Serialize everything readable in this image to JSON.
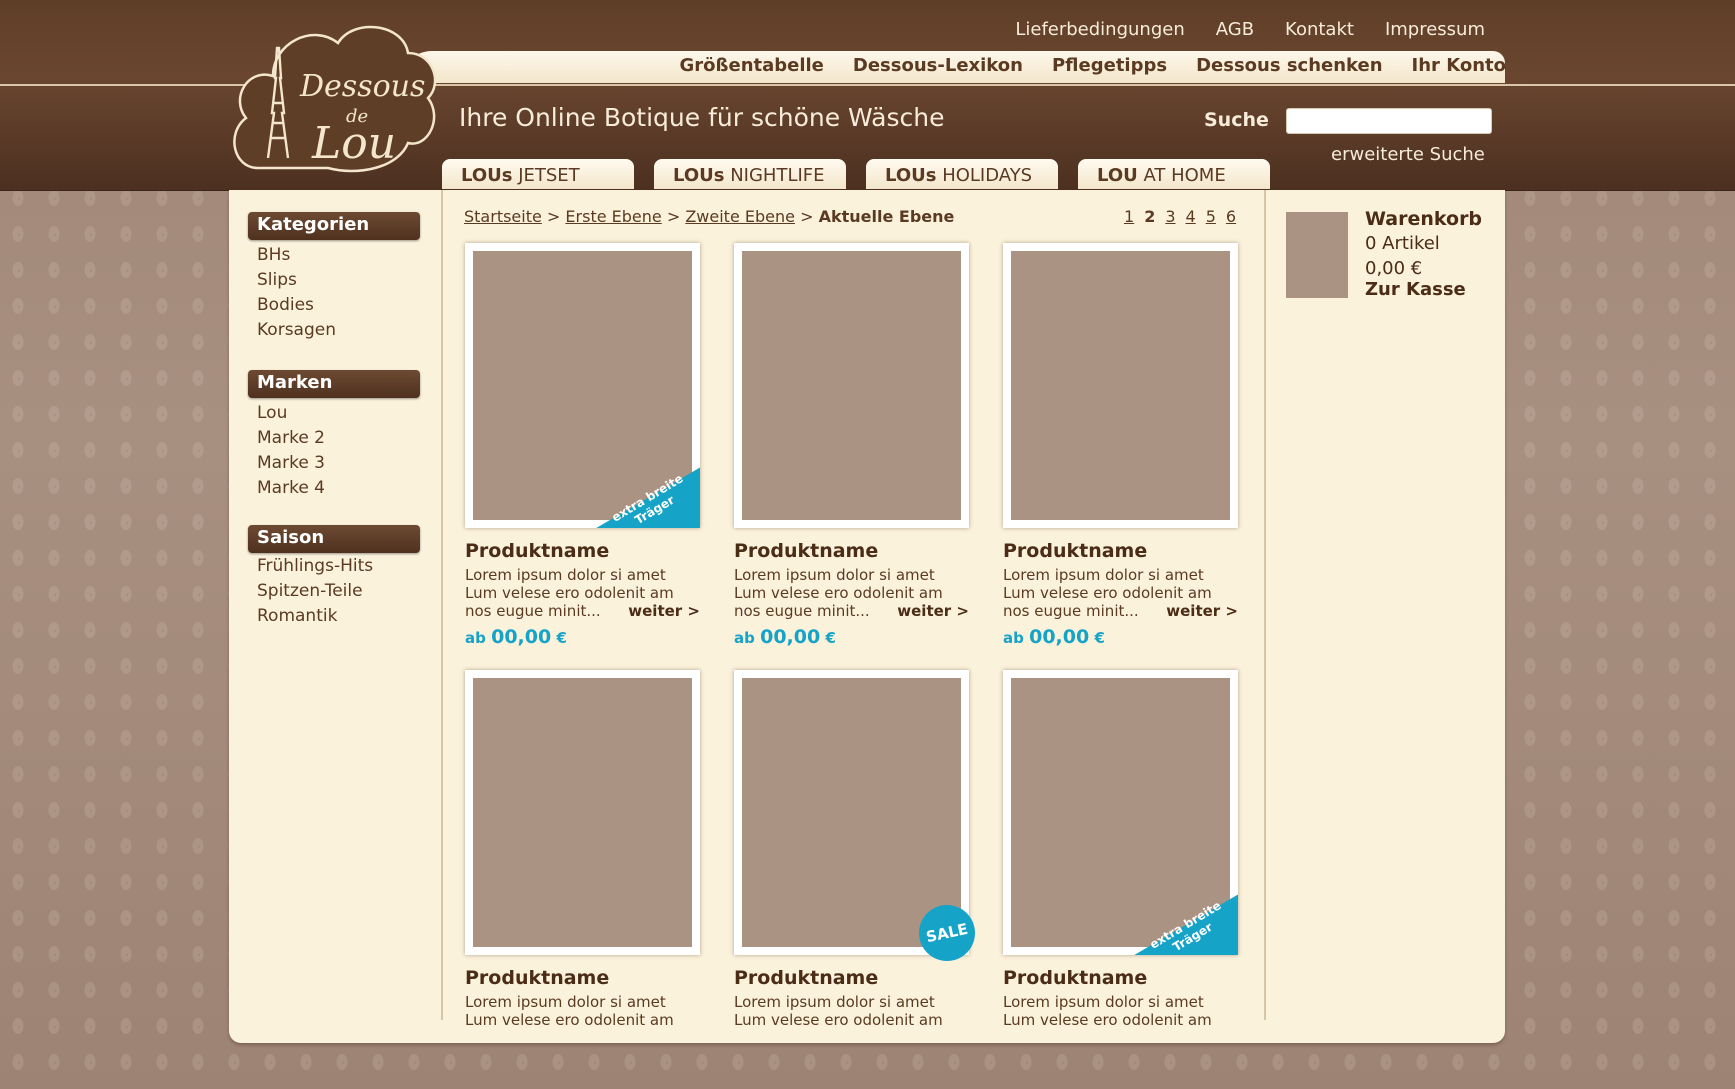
{
  "header": {
    "logo_text_1": "Dessous",
    "logo_text_2": "de",
    "logo_text_3": "Lou",
    "top_links": [
      "Lieferbedingungen",
      "AGB",
      "Kontakt",
      "Impressum"
    ],
    "main_links": [
      "Größentabelle",
      "Dessous-Lexikon",
      "Pflegetipps",
      "Dessous schenken",
      "Ihr Konto"
    ],
    "tagline": "Ihre Online Botique für schöne Wäsche",
    "search_label": "Suche",
    "search_value": "",
    "advanced_search": "erweiterte Suche",
    "tabs": [
      {
        "bold": "LOUs",
        "rest": " JETSET"
      },
      {
        "bold": "LOUs",
        "rest": " NIGHTLIFE"
      },
      {
        "bold": "LOUs",
        "rest": " HOLIDAYS"
      },
      {
        "bold": "LOU",
        "rest": " AT HOME"
      }
    ]
  },
  "sidebar": {
    "kategorien": {
      "title": "Kategorien",
      "items": [
        "BHs",
        "Slips",
        "Bodies",
        "Korsagen"
      ]
    },
    "marken": {
      "title": "Marken",
      "items": [
        "Lou",
        "Marke 2",
        "Marke 3",
        "Marke 4"
      ]
    },
    "saison": {
      "title": "Saison",
      "items": [
        "Frühlings-Hits",
        "Spitzen-Teile",
        "Romantik"
      ]
    }
  },
  "breadcrumb": {
    "links": [
      "Startseite",
      "Erste Ebene",
      "Zweite Ebene"
    ],
    "separator": ">",
    "current": "Aktuelle Ebene"
  },
  "pager": [
    "1",
    "2",
    "3",
    "4",
    "5",
    "6"
  ],
  "pager_active": "2",
  "products": [
    {
      "name": "Produktname",
      "desc1": "Lorem ipsum dolor si amet",
      "desc2": "Lum velese ero odolenit am",
      "desc3": "nos eugue minit...",
      "more": "weiter >",
      "price_prefix": "ab",
      "price": "00,00",
      "currency": "€",
      "badge": "ribbon",
      "badge_text_1": "extra breite",
      "badge_text_2": "Träger"
    },
    {
      "name": "Produktname",
      "desc1": "Lorem ipsum dolor si amet",
      "desc2": "Lum velese ero odolenit am",
      "desc3": "nos eugue minit...",
      "more": "weiter >",
      "price_prefix": "ab",
      "price": "00,00",
      "currency": "€",
      "badge": "none"
    },
    {
      "name": "Produktname",
      "desc1": "Lorem ipsum dolor si amet",
      "desc2": "Lum velese ero odolenit am",
      "desc3": "nos eugue minit...",
      "more": "weiter >",
      "price_prefix": "ab",
      "price": "00,00",
      "currency": "€",
      "badge": "none"
    },
    {
      "name": "Produktname",
      "desc1": "Lorem ipsum dolor si amet",
      "desc2": "Lum velese ero odolenit am",
      "badge": "none"
    },
    {
      "name": "Produktname",
      "desc1": "Lorem ipsum dolor si amet",
      "desc2": "Lum velese ero odolenit am",
      "badge": "sale",
      "badge_text_1": "SALE"
    },
    {
      "name": "Produktname",
      "desc1": "Lorem ipsum dolor si amet",
      "desc2": "Lum velese ero odolenit am",
      "badge": "ribbon",
      "badge_text_1": "extra breite",
      "badge_text_2": "Träger"
    }
  ],
  "cart": {
    "title": "Warenkorb",
    "items": "0 Artikel",
    "total": "0,00 €",
    "checkout": "Zur Kasse"
  },
  "colors": {
    "brown_dark": "#4e311f",
    "cream": "#fbf2dc",
    "accent_blue": "#15a3c7",
    "placeholder": "#ab9383"
  }
}
